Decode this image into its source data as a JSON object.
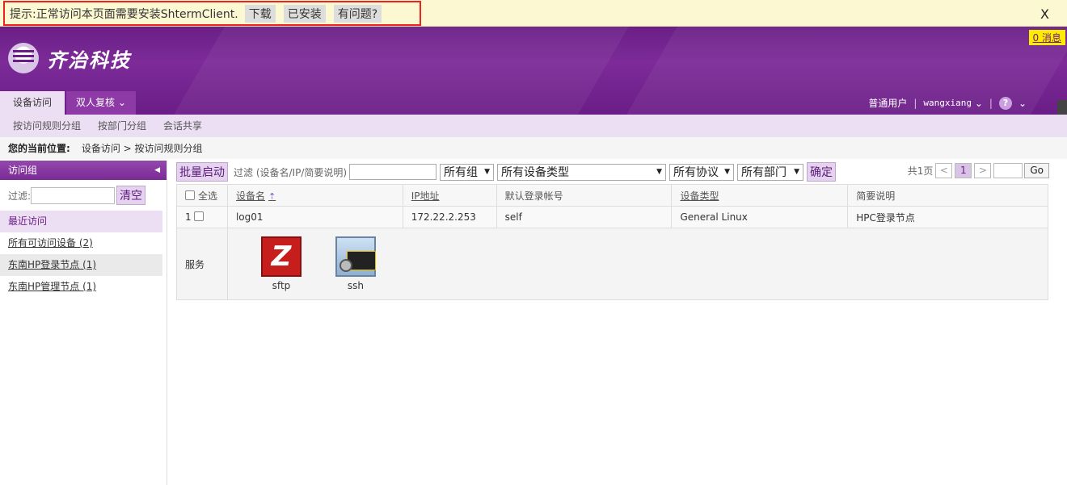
{
  "notice": {
    "text": "提示:正常访问本页面需要安装ShtermClient.",
    "download": "下载",
    "installed": "已安装",
    "question": "有问题?",
    "close": "X"
  },
  "header": {
    "brand": "齐治科技",
    "messages": "0 消息",
    "tabs": [
      "设备访问",
      "双人复核"
    ],
    "role": "普通用户",
    "sep": "|",
    "username": "wangxiang",
    "help": "?"
  },
  "subnav": [
    "按访问规则分组",
    "按部门分组",
    "会话共享"
  ],
  "breadcrumb": {
    "label": "您的当前位置:",
    "path": "设备访问 > 按访问规则分组"
  },
  "sidebar": {
    "title": "访问组",
    "filter_label": "过滤:",
    "clear": "清空",
    "recent": "最近访问",
    "items": [
      "所有可访问设备 (2)",
      "东南HP登录节点 (1)",
      "东南HP管理节点 (1)"
    ]
  },
  "toolbar": {
    "batch": "批量启动",
    "filter_label": "过滤 (设备名/IP/简要说明)",
    "group": "所有组",
    "device_type": "所有设备类型",
    "protocol": "所有协议",
    "department": "所有部门",
    "confirm": "确定",
    "total_pages": "共1页",
    "prev": "<",
    "page": "1",
    "next": ">",
    "go": "Go"
  },
  "table": {
    "headers": {
      "select_all": "全选",
      "name": "设备名",
      "ip": "IP地址",
      "account": "默认登录帐号",
      "type": "设备类型",
      "desc": "简要说明"
    },
    "row": {
      "index": "1",
      "name": "log01",
      "ip": "172.22.2.253",
      "account": "self",
      "type": "General Linux",
      "desc": "HPC登录节点"
    },
    "services_label": "服务",
    "services": [
      "sftp",
      "ssh"
    ]
  },
  "colors": {
    "brand": "#6b1d87",
    "notice_bg": "#fbf8d2",
    "highlight": "#e22222",
    "message_badge": "#ffeb00"
  }
}
